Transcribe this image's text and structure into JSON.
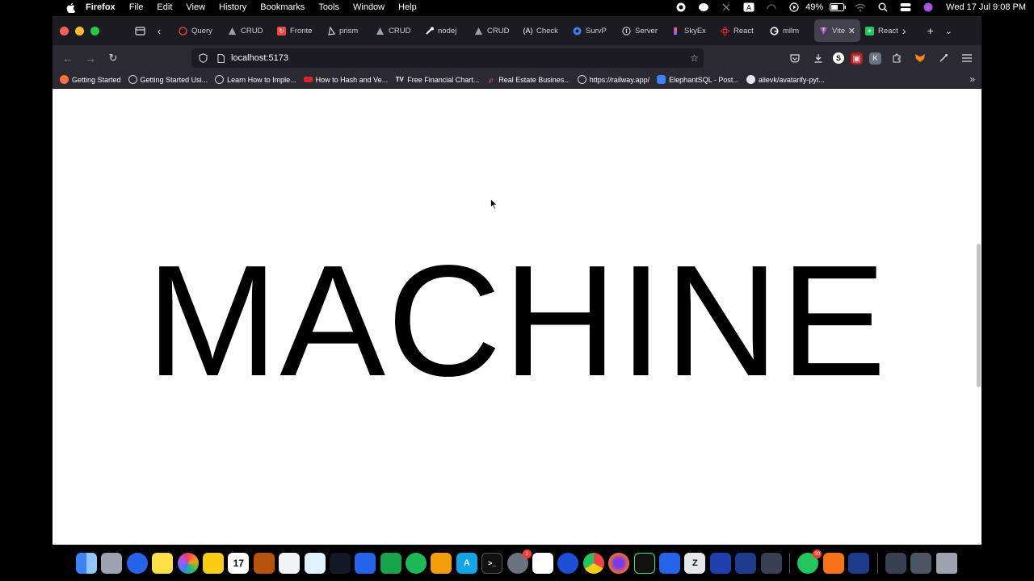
{
  "menubar": {
    "app_name": "Firefox",
    "items": [
      "File",
      "Edit",
      "View",
      "History",
      "Bookmarks",
      "Tools",
      "Window",
      "Help"
    ],
    "battery": "49%",
    "clock": "Wed 17 Jul  9:08 PM"
  },
  "tabs": [
    {
      "label": "Query",
      "icon": "react-query-icon",
      "color": "#ef4444"
    },
    {
      "label": "CRUD",
      "icon": "triangle-icon",
      "color": "#6b7280"
    },
    {
      "label": "Fronte",
      "icon": "frontend-icon",
      "color": "#ef4444"
    },
    {
      "label": "prism",
      "icon": "prisma-icon",
      "color": "#4b5563"
    },
    {
      "label": "CRUD",
      "icon": "triangle-icon",
      "color": "#6b7280"
    },
    {
      "label": "nodej",
      "icon": "node-icon",
      "color": "#9ca3af"
    },
    {
      "label": "CRUD",
      "icon": "triangle-icon",
      "color": "#6b7280"
    },
    {
      "label": "Check",
      "icon": "angular-icon",
      "color": "#4b5563"
    },
    {
      "label": "SurvP",
      "icon": "survey-icon",
      "color": "#3b82f6"
    },
    {
      "label": "Server",
      "icon": "info-icon",
      "color": "#6b7280"
    },
    {
      "label": "SkyEx",
      "icon": "skyex-icon",
      "color": "#a855f7"
    },
    {
      "label": "React",
      "icon": "react-icon",
      "color": "#dc2626"
    },
    {
      "label": "mllm",
      "icon": "google-icon",
      "color": "#ffffff"
    },
    {
      "label": "Vite",
      "icon": "vite-icon",
      "color": "#a855f7",
      "active": true
    },
    {
      "label": "React",
      "icon": "puzzle-icon",
      "color": "#22c55e"
    }
  ],
  "navbar": {
    "url": "localhost:5173"
  },
  "bookmarks": [
    {
      "label": "Getting Started",
      "color": "#ff7139"
    },
    {
      "label": "Getting Started Usi...",
      "color": "#6b7280"
    },
    {
      "label": "Learn How to Imple...",
      "color": "#6b7280"
    },
    {
      "label": "How to Hash and Ve...",
      "color": "#dc2626"
    },
    {
      "label": "Free Financial Chart...",
      "color": "#111827"
    },
    {
      "label": "Real Estate Busines...",
      "color": "#b91c1c"
    },
    {
      "label": "https://railway.app/",
      "color": "#6b7280"
    },
    {
      "label": "ElephantSQL - Post...",
      "color": "#3b82f6"
    },
    {
      "label": "alievk/avatarify-pyt...",
      "color": "#e5e7eb"
    }
  ],
  "page": {
    "hero_text": "MACHINE"
  },
  "dock": {
    "badge_1": "2",
    "badge_2": "30"
  }
}
